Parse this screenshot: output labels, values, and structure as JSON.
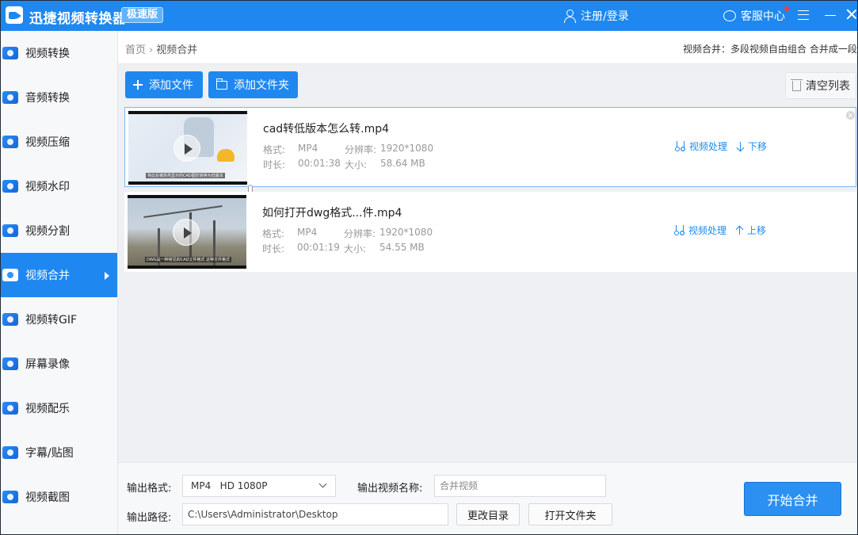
{
  "titlebar": {
    "app_title": "迅捷视频转换器",
    "badge": "极速版",
    "login": "注册/登录",
    "service": "客服中心"
  },
  "sidebar": {
    "items": [
      {
        "label": "视频转换",
        "icon": "video-convert-icon",
        "active": false
      },
      {
        "label": "音频转换",
        "icon": "audio-convert-icon",
        "active": false
      },
      {
        "label": "视频压缩",
        "icon": "video-compress-icon",
        "active": false
      },
      {
        "label": "视频水印",
        "icon": "video-watermark-icon",
        "active": false
      },
      {
        "label": "视频分割",
        "icon": "video-split-icon",
        "active": false
      },
      {
        "label": "视频合并",
        "icon": "video-merge-icon",
        "active": true
      },
      {
        "label": "视频转GIF",
        "icon": "gif-icon",
        "active": false
      },
      {
        "label": "屏幕录像",
        "icon": "screen-record-icon",
        "active": false
      },
      {
        "label": "视频配乐",
        "icon": "music-icon",
        "active": false
      },
      {
        "label": "字幕/贴图",
        "icon": "subtitle-sticker-icon",
        "active": false
      },
      {
        "label": "视频截图",
        "icon": "screenshot-icon",
        "active": false
      }
    ]
  },
  "breadcrumb": {
    "home": "首页",
    "separator": "›",
    "current": "视频合并"
  },
  "tip": "视频合并：多段视频自由组合 合并成一段",
  "toolbar": {
    "add_file": "添加文件",
    "add_folder": "添加文件夹",
    "clear_list": "清空列表"
  },
  "files": [
    {
      "name": "cad转低版本怎么转.mp4",
      "format_label": "格式:",
      "format": "MP4",
      "resolution_label": "分辨率:",
      "resolution": "1920*1080",
      "duration_label": "时长:",
      "duration": "00:01:38",
      "size_label": "大小:",
      "size": "58.64 MB",
      "process": "视频处理",
      "move": "下移",
      "caption": "将此处被高亮显示的CAD图形转换为低版本"
    },
    {
      "name": "如何打开dwg格式...件.mp4",
      "format_label": "格式:",
      "format": "MP4",
      "resolution_label": "分辨率:",
      "resolution": "1920*1080",
      "duration_label": "时长:",
      "duration": "00:01:19",
      "size_label": "大小:",
      "size": "54.55 MB",
      "process": "视频处理",
      "move": "上移",
      "caption": "DWG是一种常见的CAD文件格式 这种文件格式"
    }
  ],
  "bottom": {
    "format_label": "输出格式:",
    "format_value": "MP4   HD 1080P",
    "name_label": "输出视频名称:",
    "name_placeholder": "合并视频",
    "path_label": "输出路径:",
    "path_value": "C:\\Users\\Administrator\\Desktop",
    "change_dir": "更改目录",
    "open_folder": "打开文件夹",
    "start": "开始合并"
  },
  "colors": {
    "accent": "#1e88f0",
    "sidebar_bg": "#f7f8fa",
    "main_bg": "#eef0f3"
  }
}
